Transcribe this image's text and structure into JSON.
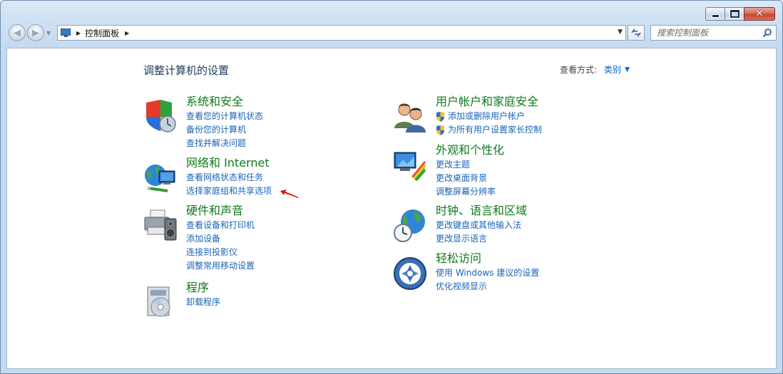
{
  "window": {
    "caption_close": "✕"
  },
  "nav": {
    "back_glyph": "◀",
    "forward_glyph": "▶",
    "address_path": "控制面板",
    "search_placeholder": "搜索控制面板"
  },
  "page": {
    "title": "调整计算机的设置",
    "view_by_label": "查看方式:",
    "view_by_value": "类别"
  },
  "categories": {
    "system": {
      "title": "系统和安全",
      "links": [
        "查看您的计算机状态",
        "备份您的计算机",
        "查找并解决问题"
      ]
    },
    "network": {
      "title": "网络和 Internet",
      "links": [
        "查看网络状态和任务",
        "选择家庭组和共享选项"
      ]
    },
    "hardware": {
      "title": "硬件和声音",
      "links": [
        "查看设备和打印机",
        "添加设备",
        "连接到投影仪",
        "调整常用移动设置"
      ]
    },
    "programs": {
      "title": "程序",
      "links": [
        "卸载程序"
      ]
    },
    "users": {
      "title": "用户帐户和家庭安全",
      "links": [
        "添加或删除用户帐户",
        "为所有用户设置家长控制"
      ]
    },
    "appearance": {
      "title": "外观和个性化",
      "links": [
        "更改主题",
        "更改桌面背景",
        "调整屏幕分辨率"
      ]
    },
    "clock": {
      "title": "时钟、语言和区域",
      "links": [
        "更改键盘或其他输入法",
        "更改显示语言"
      ]
    },
    "ease": {
      "title": "轻松访问",
      "links": [
        "使用 Windows 建议的设置",
        "优化视频显示"
      ]
    }
  },
  "colors": {
    "category_title": "#0e7a1a",
    "link": "#1a63b8",
    "annotation_arrow": "#e01010"
  }
}
